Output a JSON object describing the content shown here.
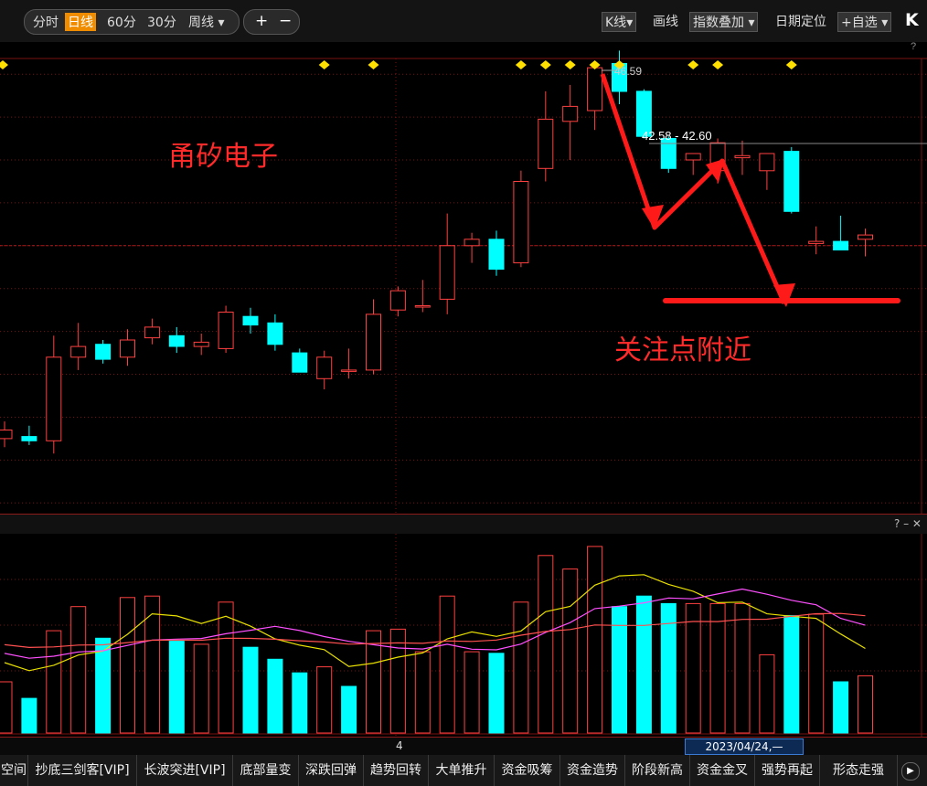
{
  "toolbar": {
    "periods": [
      "分时",
      "日线",
      "60分",
      "30分"
    ],
    "week_label": "周线",
    "kline_label": "K线",
    "draw_label": "画线",
    "index_overlay_label": "指数叠加",
    "date_locate_label": "日期定位",
    "watchlist_label": "+自选",
    "help": "?"
  },
  "annotations": {
    "stock_name": "甬矽电子",
    "focus_note": "关注点附近",
    "high_label": "46.59",
    "range_label": "42.58 - 42.60"
  },
  "sub_panel": {
    "controls": "? – ✕",
    "cursor_index": "4",
    "date_box": "2023/04/24,—"
  },
  "tabs": [
    "空间",
    "抄底三剑客[VIP]",
    "长波突进[VIP]",
    "底部量变",
    "深跌回弹",
    "趋势回转",
    "大单推升",
    "资金吸筹",
    "资金造势",
    "阶段新高",
    "资金金叉",
    "强势再起",
    "形态走强"
  ],
  "colors": {
    "up": "#ff4040",
    "down": "#00ffff",
    "ma_yellow": "#e8e000",
    "ma_magenta": "#ff50ff",
    "ma_red": "#ff5050",
    "diamond": "#ffe000",
    "grid": "#7a1010"
  },
  "candles": [
    {
      "o": 31.0,
      "h": 31.8,
      "l": 30.6,
      "c": 31.4
    },
    {
      "o": 31.1,
      "h": 31.6,
      "l": 30.7,
      "c": 30.9
    },
    {
      "o": 30.9,
      "h": 35.8,
      "l": 30.3,
      "c": 34.8
    },
    {
      "o": 34.8,
      "h": 36.4,
      "l": 34.2,
      "c": 35.3
    },
    {
      "o": 35.4,
      "h": 35.6,
      "l": 34.5,
      "c": 34.7
    },
    {
      "o": 34.8,
      "h": 36.1,
      "l": 34.4,
      "c": 35.6
    },
    {
      "o": 35.7,
      "h": 36.6,
      "l": 35.4,
      "c": 36.2
    },
    {
      "o": 35.8,
      "h": 36.2,
      "l": 35.0,
      "c": 35.3
    },
    {
      "o": 35.3,
      "h": 35.9,
      "l": 34.9,
      "c": 35.5
    },
    {
      "o": 35.2,
      "h": 37.2,
      "l": 35.0,
      "c": 36.9
    },
    {
      "o": 36.7,
      "h": 37.1,
      "l": 35.9,
      "c": 36.3
    },
    {
      "o": 36.4,
      "h": 36.8,
      "l": 35.1,
      "c": 35.4
    },
    {
      "o": 35.0,
      "h": 35.2,
      "l": 34.1,
      "c": 34.1
    },
    {
      "o": 33.8,
      "h": 35.1,
      "l": 33.3,
      "c": 34.8
    },
    {
      "o": 34.2,
      "h": 35.2,
      "l": 33.8,
      "c": 34.2
    },
    {
      "o": 34.2,
      "h": 37.5,
      "l": 34.0,
      "c": 36.8
    },
    {
      "o": 37.0,
      "h": 38.1,
      "l": 36.7,
      "c": 37.9
    },
    {
      "o": 37.2,
      "h": 38.4,
      "l": 36.9,
      "c": 37.2
    },
    {
      "o": 37.5,
      "h": 41.5,
      "l": 36.8,
      "c": 40.0
    },
    {
      "o": 40.0,
      "h": 40.6,
      "l": 39.2,
      "c": 40.3
    },
    {
      "o": 40.3,
      "h": 40.7,
      "l": 38.6,
      "c": 38.9
    },
    {
      "o": 39.2,
      "h": 43.5,
      "l": 39.0,
      "c": 43.0
    },
    {
      "o": 43.6,
      "h": 47.2,
      "l": 43.0,
      "c": 45.9
    },
    {
      "o": 45.8,
      "h": 47.5,
      "l": 44.0,
      "c": 46.5
    },
    {
      "o": 46.3,
      "h": 48.5,
      "l": 45.4,
      "c": 48.3
    },
    {
      "o": 48.5,
      "h": 49.1,
      "l": 46.6,
      "c": 47.2
    },
    {
      "o": 47.2,
      "h": 47.3,
      "l": 45.0,
      "c": 45.1
    },
    {
      "o": 45.0,
      "h": 45.1,
      "l": 43.4,
      "c": 43.6
    },
    {
      "o": 44.0,
      "h": 44.3,
      "l": 43.3,
      "c": 44.3
    },
    {
      "o": 43.5,
      "h": 45.0,
      "l": 42.9,
      "c": 44.8
    },
    {
      "o": 44.1,
      "h": 44.9,
      "l": 43.3,
      "c": 44.2
    },
    {
      "o": 43.5,
      "h": 44.3,
      "l": 42.6,
      "c": 44.3
    },
    {
      "o": 44.4,
      "h": 44.6,
      "l": 41.5,
      "c": 41.6
    },
    {
      "o": 40.1,
      "h": 40.9,
      "l": 39.6,
      "c": 40.2
    },
    {
      "o": 40.2,
      "h": 41.4,
      "l": 39.8,
      "c": 39.8
    },
    {
      "o": 40.3,
      "h": 40.8,
      "l": 39.5,
      "c": 40.5
    }
  ],
  "volumes": [
    {
      "v": 34,
      "up": true
    },
    {
      "v": 23,
      "up": false
    },
    {
      "v": 68,
      "up": true
    },
    {
      "v": 84,
      "up": true
    },
    {
      "v": 63,
      "up": false
    },
    {
      "v": 90,
      "up": true
    },
    {
      "v": 91,
      "up": true
    },
    {
      "v": 61,
      "up": false
    },
    {
      "v": 59,
      "up": true
    },
    {
      "v": 87,
      "up": true
    },
    {
      "v": 57,
      "up": false
    },
    {
      "v": 49,
      "up": false
    },
    {
      "v": 40,
      "up": false
    },
    {
      "v": 44,
      "up": true
    },
    {
      "v": 31,
      "up": false
    },
    {
      "v": 68,
      "up": true
    },
    {
      "v": 69,
      "up": true
    },
    {
      "v": 54,
      "up": true
    },
    {
      "v": 91,
      "up": true
    },
    {
      "v": 54,
      "up": true
    },
    {
      "v": 53,
      "up": false
    },
    {
      "v": 87,
      "up": true
    },
    {
      "v": 118,
      "up": true
    },
    {
      "v": 109,
      "up": true
    },
    {
      "v": 124,
      "up": true
    },
    {
      "v": 84,
      "up": false
    },
    {
      "v": 91,
      "up": false
    },
    {
      "v": 86,
      "up": false
    },
    {
      "v": 86,
      "up": true
    },
    {
      "v": 86,
      "up": true
    },
    {
      "v": 86,
      "up": true
    },
    {
      "v": 52,
      "up": true
    },
    {
      "v": 78,
      "up": false
    },
    {
      "v": 79,
      "up": true
    },
    {
      "v": 34,
      "up": false
    },
    {
      "v": 38,
      "up": true
    }
  ],
  "signals": [
    0,
    13,
    15,
    21,
    22,
    23,
    24,
    25,
    28,
    29,
    32
  ]
}
